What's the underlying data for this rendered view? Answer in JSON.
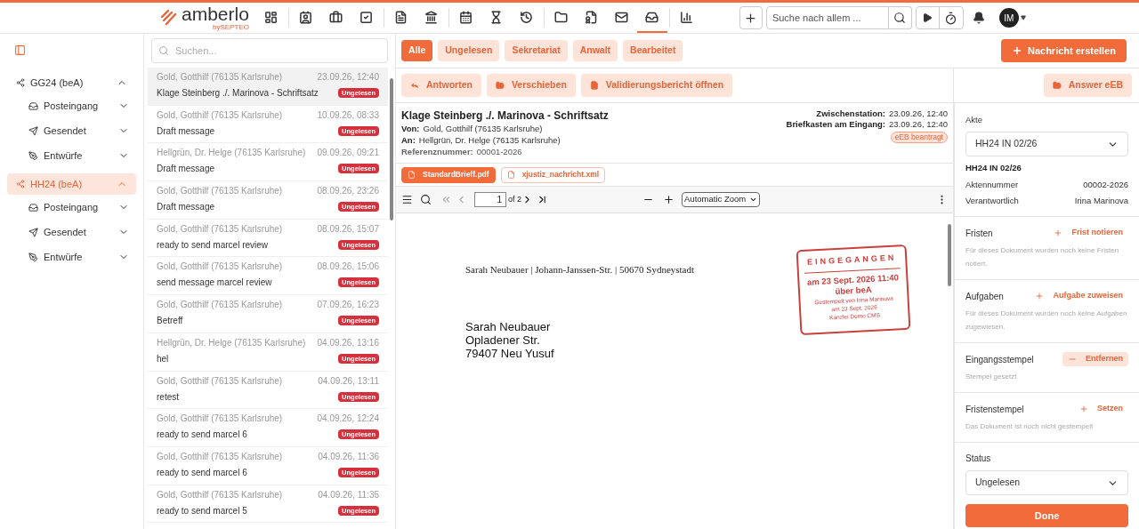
{
  "header": {
    "logo": "amberlo",
    "logo_sub": "bySEPTEO",
    "nav": [
      {
        "selected": false
      },
      {
        "selected": false
      },
      {
        "selected": false
      },
      {
        "selected": false
      },
      {
        "selected": false
      },
      {
        "selected": false
      },
      {
        "selected": false
      },
      {
        "selected": false
      },
      {
        "selected": false
      },
      {
        "selected": false
      },
      {
        "selected": false
      },
      {
        "selected": false
      },
      {
        "selected": true
      },
      {
        "selected": false
      }
    ],
    "search_placeholder": "Suche nach allem ...",
    "avatar": "IM"
  },
  "sidebar": {
    "groups": [
      {
        "label": "GG24 (beA)",
        "selected": false,
        "expanded": true,
        "children": [
          {
            "label": "Posteingang",
            "expanded": false
          },
          {
            "label": "Gesendet",
            "expanded": false
          },
          {
            "label": "Entwürfe",
            "expanded": false
          }
        ]
      },
      {
        "label": "HH24 (beA)",
        "selected": true,
        "expanded": true,
        "children": [
          {
            "label": "Posteingang",
            "expanded": false
          },
          {
            "label": "Gesendet",
            "expanded": false
          },
          {
            "label": "Entwürfe",
            "expanded": false
          }
        ]
      }
    ]
  },
  "message_list": {
    "search_placeholder": "Suchen...",
    "messages": [
      {
        "sender": "Gold, Gotthilf (76135 Karlsruhe)",
        "date": "23.09.26, 12:40",
        "subject": "Klage Steinberg ./. Marinova - Schriftsatz",
        "badge": "Ungelesen",
        "selected": true
      },
      {
        "sender": "Gold, Gotthilf (76135 Karlsruhe)",
        "date": "10.09.26, 08:33",
        "subject": "Draft message",
        "badge": "Ungelesen",
        "selected": false
      },
      {
        "sender": "Hellgrün, Dr. Helge (76135 Karlsruhe)",
        "date": "09.09.26, 09:21",
        "subject": "Draft message",
        "badge": "Ungelesen",
        "selected": false
      },
      {
        "sender": "Gold, Gotthilf (76135 Karlsruhe)",
        "date": "08.09.26, 23:26",
        "subject": "Draft message",
        "badge": "Ungelesen",
        "selected": false
      },
      {
        "sender": "Gold, Gotthilf (76135 Karlsruhe)",
        "date": "08.09.26, 15:07",
        "subject": "ready to send marcel review",
        "badge": "Ungelesen",
        "selected": false
      },
      {
        "sender": "Gold, Gotthilf (76135 Karlsruhe)",
        "date": "08.09.26, 15:06",
        "subject": "send message marcel review",
        "badge": "Ungelesen",
        "selected": false
      },
      {
        "sender": "Gold, Gotthilf (76135 Karlsruhe)",
        "date": "07.09.26, 16:23",
        "subject": "Betreff",
        "badge": "Ungelesen",
        "selected": false
      },
      {
        "sender": "Hellgrün, Dr. Helge (76135 Karlsruhe)",
        "date": "04.09.26, 13:16",
        "subject": "hel",
        "badge": "Ungelesen",
        "selected": false
      },
      {
        "sender": "Gold, Gotthilf (76135 Karlsruhe)",
        "date": "04.09.26, 13:11",
        "subject": "retest",
        "badge": "Ungelesen",
        "selected": false
      },
      {
        "sender": "Gold, Gotthilf (76135 Karlsruhe)",
        "date": "04.09.26, 12:24",
        "subject": "ready to send marcel 6",
        "badge": "Ungelesen",
        "selected": false
      },
      {
        "sender": "Gold, Gotthilf (76135 Karlsruhe)",
        "date": "04.09.26, 11:36",
        "subject": "ready to send marcel 6",
        "badge": "Ungelesen",
        "selected": false
      },
      {
        "sender": "Gold, Gotthilf (76135 Karlsruhe)",
        "date": "04.09.26, 11:35",
        "subject": "ready to send marcel 5",
        "badge": "Ungelesen",
        "selected": false
      }
    ]
  },
  "filters": [
    {
      "label": "Alle",
      "selected": true
    },
    {
      "label": "Ungelesen",
      "selected": false
    },
    {
      "label": "Sekretariat",
      "selected": false
    },
    {
      "label": "Anwalt",
      "selected": false
    },
    {
      "label": "Bearbeitet",
      "selected": false
    }
  ],
  "create_button": "Nachricht erstellen",
  "actions": [
    {
      "label": "Antworten",
      "kind": "reply"
    },
    {
      "label": "Verschieben",
      "kind": "move"
    },
    {
      "label": "Validierungsbericht öffnen",
      "kind": "report"
    }
  ],
  "answer_button": "Answer eEB",
  "message": {
    "subject": "Klage Steinberg ./. Marinova - Schriftsatz",
    "fields": [
      {
        "label": "Von:",
        "value": "Gold, Gotthilf (76135 Karlsruhe)"
      },
      {
        "label": "An:",
        "value": "Hellgrün, Dr. Helge (76135 Karlsruhe)"
      },
      {
        "label": "Referenznummer:",
        "value": "00001-2026",
        "kind": "muted"
      }
    ],
    "meta": [
      {
        "label": "Zwischenstation:",
        "value": "23.09.26, 12:40"
      },
      {
        "label": "Briefkasten am Eingang:",
        "value": "23.09.26, 12:40"
      }
    ],
    "tag": "eEB beantragt",
    "attachments": [
      {
        "name": "StandardBrieff.pdf",
        "selected": true
      },
      {
        "name": "xjustiz_nachricht.xml",
        "selected": false
      }
    ]
  },
  "pdf_toolbar": {
    "page": "1",
    "page_count": "of 2",
    "zoom": "Automatic Zoom"
  },
  "document": {
    "sender_line": "Sarah Neubauer | Johann-Janssen-Str. | 50670 Sydneystadt",
    "address": [
      "Sarah Neubauer",
      "Opladener Str.",
      "79407 Neu Yusuf"
    ],
    "stamp": {
      "title": "EINGEGANGEN",
      "lines": [
        "am 23 Sept. 2026 11:40",
        "über beA"
      ],
      "small": [
        "Gestempelt von Irina Marinova",
        "am 23 Sept. 2026",
        "Kanzlei Demo CMS"
      ]
    }
  },
  "details": {
    "akte_label": "Akte",
    "akte_value": "HH24 IN 02/26",
    "akte_name": "HH24 IN 02/26",
    "rows": [
      {
        "label": "Aktennummer",
        "value": "00002-2026"
      },
      {
        "label": "Verantwortlich",
        "value": "Irina Marinova"
      }
    ],
    "sections": [
      {
        "title": "Fristen",
        "action": "Frist notieren",
        "kind": "add",
        "note": "Für dieses Dokument wurden noch keine Fristen notiert."
      },
      {
        "title": "Aufgaben",
        "action": "Aufgabe zuweisen",
        "kind": "add",
        "note": "Für dieses Dokument wurden noch keine Aufgaben zugewiesen."
      },
      {
        "title": "Eingangsstempel",
        "action": "Entfernen",
        "kind": "remove",
        "note": "Stempel gesetzt"
      },
      {
        "title": "Fristenstempel",
        "action": "Setzen",
        "kind": "add",
        "note": "Das Dokument ist noch nicht gestempelt"
      }
    ],
    "status_label": "Status",
    "status_value": "Ungelesen",
    "done": "Done"
  }
}
